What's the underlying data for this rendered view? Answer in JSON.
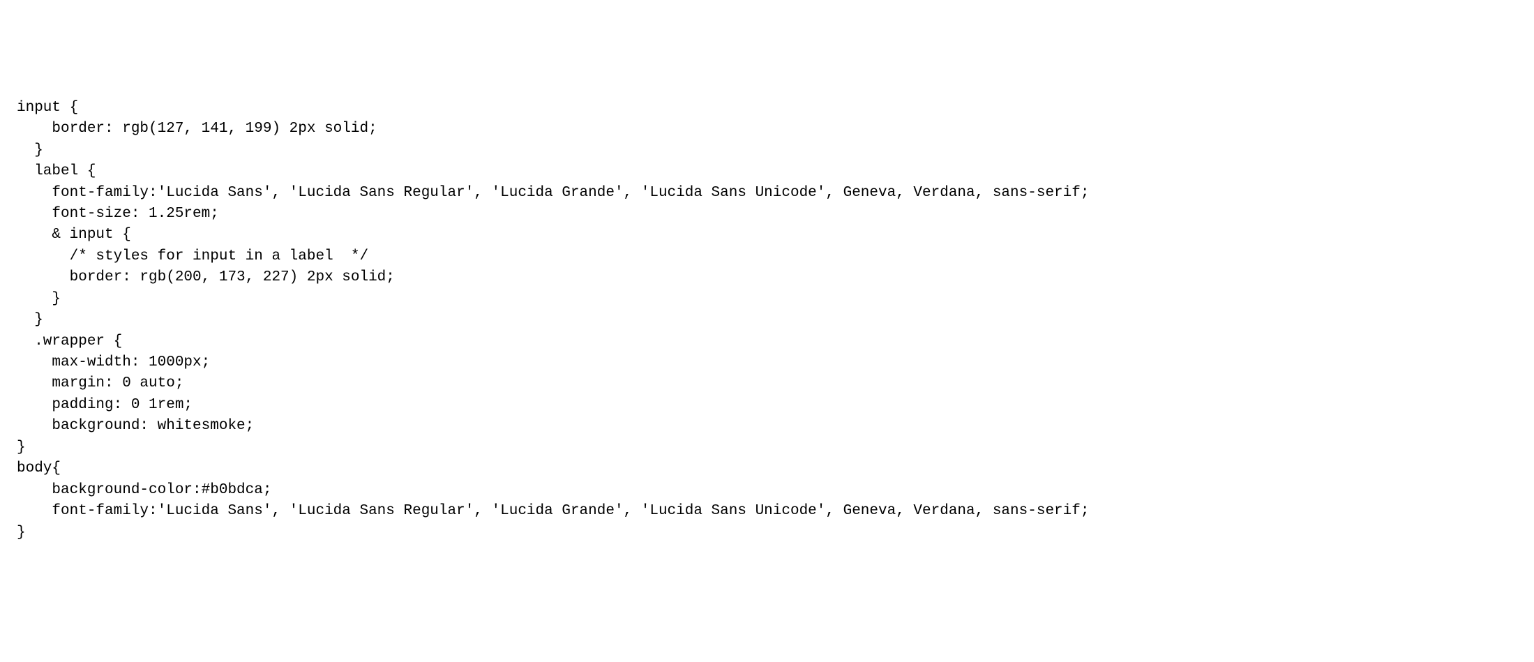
{
  "code": {
    "lines": [
      {
        "indent": 0,
        "text": "input {"
      },
      {
        "indent": 2,
        "text": "border: rgb(127, 141, 199) 2px solid;"
      },
      {
        "indent": 1,
        "text": "}"
      },
      {
        "indent": 1,
        "text": "label {"
      },
      {
        "indent": 2,
        "text": "font-family:'Lucida Sans', 'Lucida Sans Regular', 'Lucida Grande', 'Lucida Sans Unicode', Geneva, Verdana, sans-serif;"
      },
      {
        "indent": 2,
        "text": "font-size: 1.25rem;"
      },
      {
        "indent": 2,
        "text": "& input {"
      },
      {
        "indent": 3,
        "text": "/* styles for input in a label  */"
      },
      {
        "indent": 3,
        "text": "border: rgb(200, 173, 227) 2px solid;"
      },
      {
        "indent": 2,
        "text": "}"
      },
      {
        "indent": 1,
        "text": "}"
      },
      {
        "indent": 1,
        "text": ".wrapper {"
      },
      {
        "indent": 2,
        "text": "max-width: 1000px;"
      },
      {
        "indent": 2,
        "text": "margin: 0 auto;"
      },
      {
        "indent": 2,
        "text": "padding: 0 1rem;"
      },
      {
        "indent": 2,
        "text": "background: whitesmoke;"
      },
      {
        "indent": 0,
        "text": "}"
      },
      {
        "indent": 0,
        "text": "body{"
      },
      {
        "indent": 2,
        "text": "background-color:#b0bdca;"
      },
      {
        "indent": 2,
        "text": "font-family:'Lucida Sans', 'Lucida Sans Regular', 'Lucida Grande', 'Lucida Sans Unicode', Geneva, Verdana, sans-serif;"
      },
      {
        "indent": 0,
        "text": "}"
      }
    ]
  }
}
